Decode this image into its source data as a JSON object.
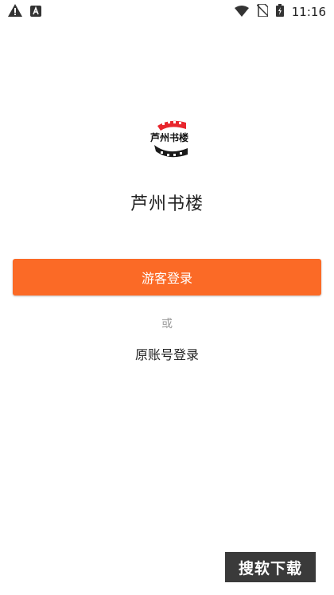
{
  "status_bar": {
    "time": "11:16",
    "left_icons": [
      "warning-icon",
      "font-a-icon"
    ],
    "right_icons": [
      "wifi-icon",
      "no-sim-icon",
      "battery-charging-icon"
    ]
  },
  "app": {
    "logo_text": "芦州书楼",
    "name": "芦州书楼"
  },
  "login": {
    "guest_button": "游客登录",
    "or": "或",
    "account_link": "原账号登录"
  },
  "watermark": "搜软下载",
  "colors": {
    "accent": "#fb6a26",
    "logo_red": "#e8262d",
    "text": "#222222",
    "muted": "#9a9a9a"
  }
}
